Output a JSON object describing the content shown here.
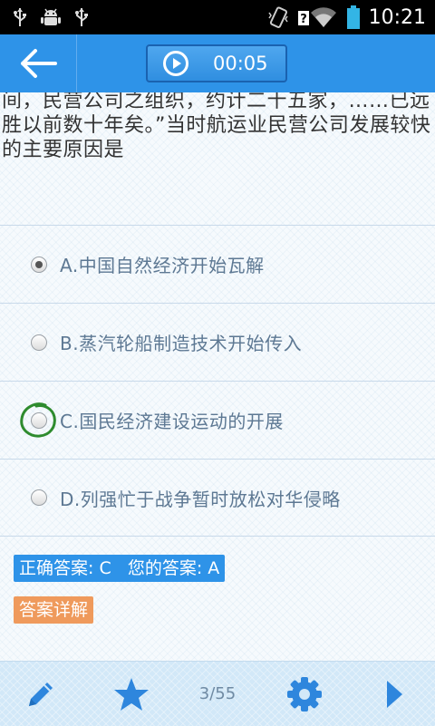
{
  "status_bar": {
    "time": "10:21",
    "left_icons": [
      "usb-icon",
      "android-debug-icon",
      "usb-icon"
    ],
    "right_icons": [
      "vibrate-icon",
      "wifi-icon",
      "battery-icon"
    ]
  },
  "header": {
    "timer": "00:05"
  },
  "question": {
    "text": "间，民营公司之组织，约计二十五家，……已远胜以前数十年矣。”当时航运业民营公司发展较快的主要原因是"
  },
  "options": [
    {
      "label": "A.中国自然经济开始瓦解",
      "selected": true
    },
    {
      "label": "B.蒸汽轮船制造技术开始传入",
      "selected": false
    },
    {
      "label": "C.国民经济建设运动的开展",
      "selected": false,
      "marked_correct": true
    },
    {
      "label": "D.列强忙于战争暂时放松对华侵略",
      "selected": false
    }
  ],
  "result": {
    "summary": "正确答案: C   您的答案: A",
    "correct_answer": "C",
    "your_answer": "A",
    "detail_button": "答案详解"
  },
  "bottom_bar": {
    "page": "3/55"
  },
  "colors": {
    "primary": "#2e93e8",
    "option_text": "#5d7893",
    "detail_button": "#ef9a5c",
    "correct_marker": "#2e8b2e",
    "icon": "#2e86dd"
  }
}
